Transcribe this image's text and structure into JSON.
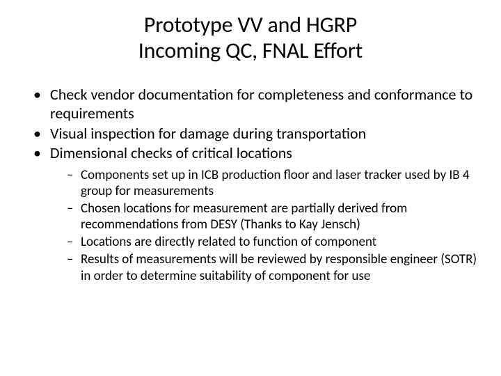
{
  "title_line1": "Prototype VV and HGRP",
  "title_line2": "Incoming QC, FNAL Effort",
  "bullets": {
    "b0": "Check vendor documentation for completeness and conformance to requirements",
    "b1": "Visual inspection for damage during transportation",
    "b2": "Dimensional checks of critical locations"
  },
  "sub": {
    "s0": "Components set up in ICB production floor and laser tracker used by IB 4 group for measurements",
    "s1": "Chosen locations for measurement are partially derived from recommendations from DESY (Thanks to Kay Jensch)",
    "s2": "Locations are directly related to function of component",
    "s3": "Results of measurements will be reviewed by responsible engineer (SOTR) in order to determine suitability of component for use"
  }
}
